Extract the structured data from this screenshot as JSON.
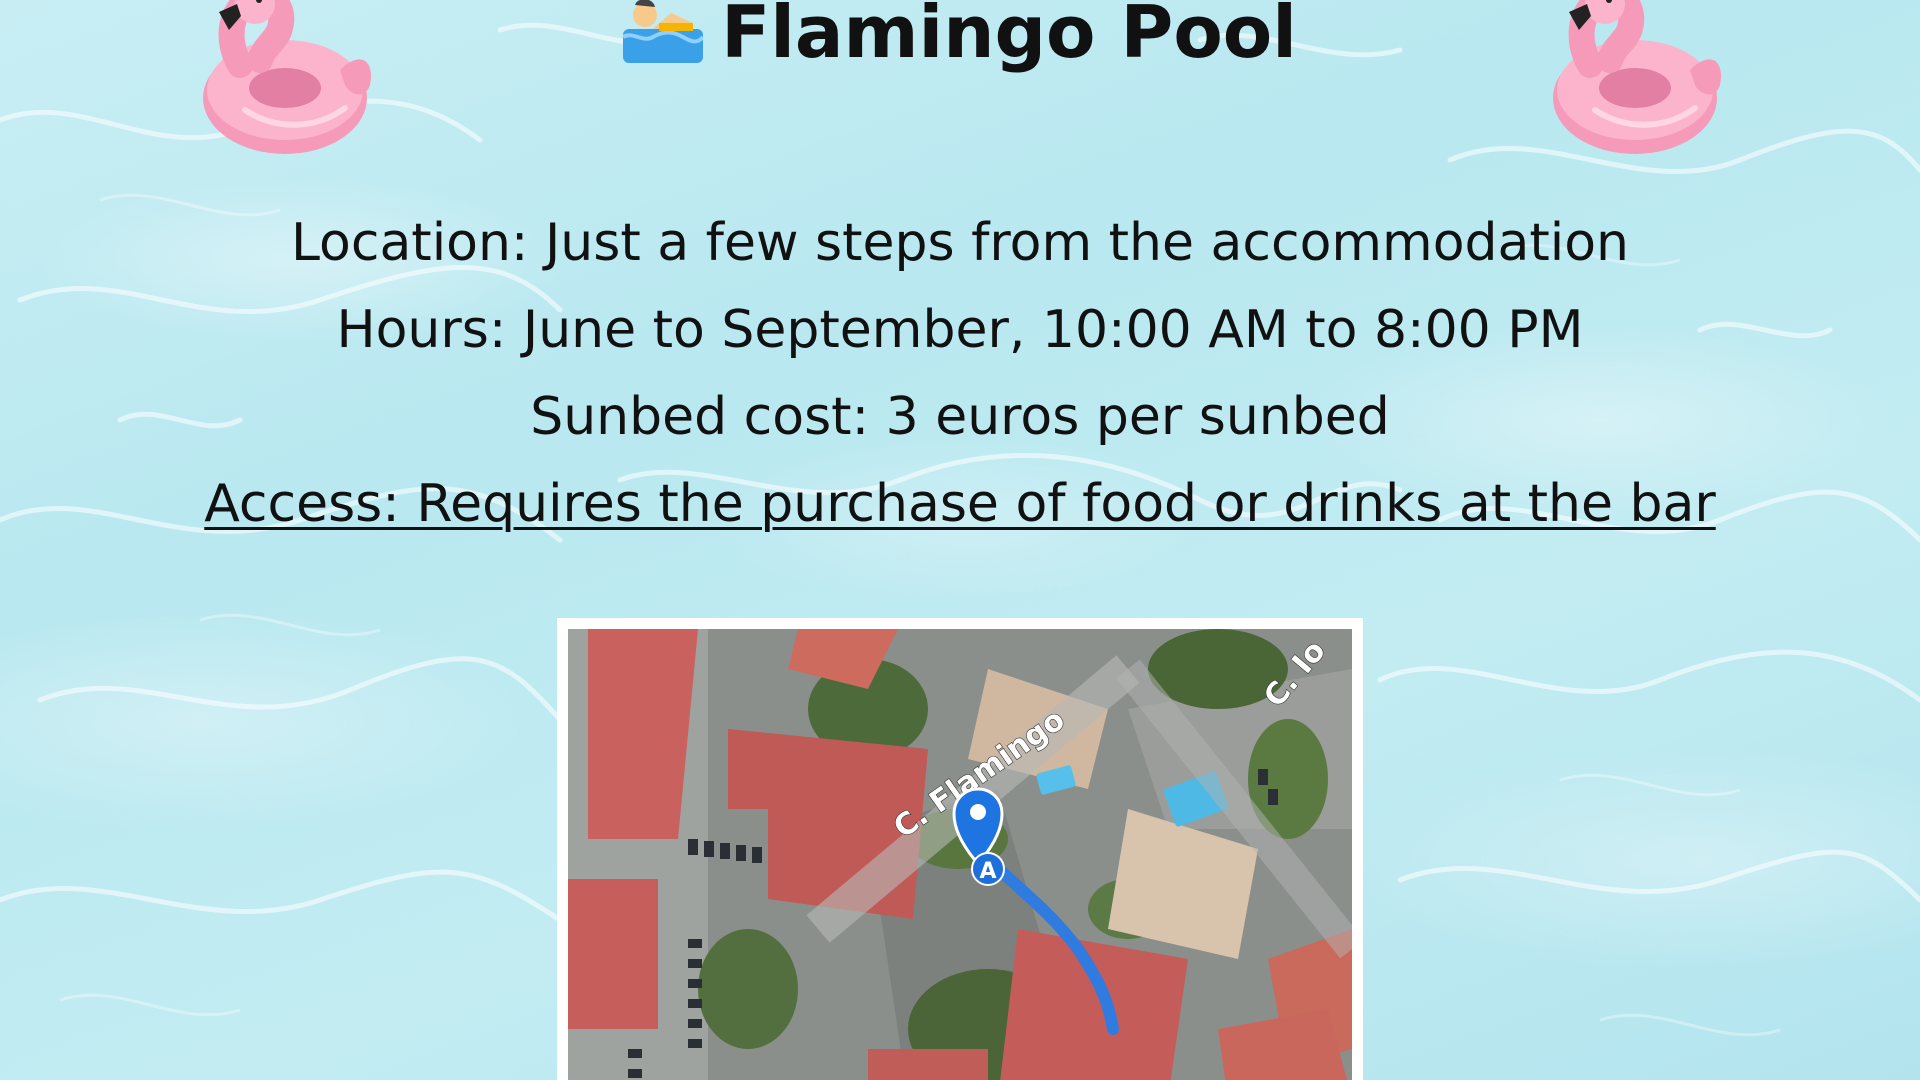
{
  "title": "Flamingo Pool",
  "title_icon": "person-swimming-icon",
  "decorations": {
    "left": "flamingo-float-icon",
    "right": "flamingo-float-icon"
  },
  "info": {
    "location": "Location: Just a few steps from the accommodation",
    "hours": "Hours: June to September, 10:00 AM to 8:00 PM",
    "sunbed": "Sunbed cost: 3 euros per sunbed",
    "access": "Access: Requires the purchase of food or drinks at the bar"
  },
  "map": {
    "street_label_main": "C. Flamingo",
    "street_label_corner": "C. Io",
    "marker_label": "A",
    "marker_icon": "map-pin-icon",
    "route_color": "#2f7be0"
  },
  "colors": {
    "water": "#c2ecf2",
    "flamingo_pink": "#f59ab8",
    "roof_red": "#c9625e"
  }
}
